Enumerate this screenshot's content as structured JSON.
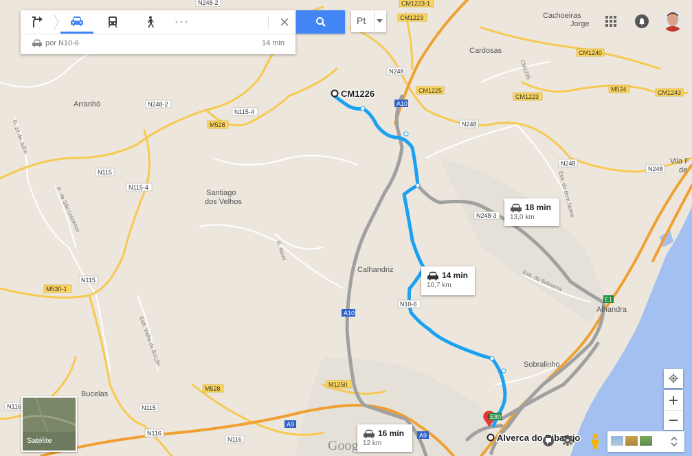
{
  "directions_panel": {
    "modes": [
      "directions",
      "car",
      "transit",
      "walking",
      "more"
    ],
    "route_summary": "por N10-6",
    "route_time": "14 min",
    "close_label": "×"
  },
  "language": {
    "selected": "Pt"
  },
  "route_boxes": {
    "primary": {
      "time": "14 min",
      "distance": "10,7 km"
    },
    "alt_east": {
      "time": "18 min",
      "distance": "13,0 km"
    },
    "alt_south": {
      "time": "16 min",
      "distance": "12 km"
    }
  },
  "markers": {
    "origin": "CM1226",
    "destination": "Alverca do Ribatejo"
  },
  "places": {
    "cachoeiras": "Cachoeiras",
    "jorge": "Jorge",
    "cardosas": "Cardosas",
    "arranho": "Arranhó",
    "santiago": "Santiago",
    "dos_velhos": "dos Velhos",
    "calhandriz": "Calhandriz",
    "alhandra": "Alhandra",
    "sobralinho": "Sobralinho",
    "bucelas": "Bucelas",
    "vila_f": "Vila F",
    "de": "de"
  },
  "streets": {
    "r_26_julho": "R. 26 de Julho",
    "r_sao_lourenco": "R. de São Lourenço",
    "r_nova": "R. Nova",
    "estr_velha": "Estr. Velha do Boição",
    "estr_bom_nome": "Estr. do Bom Nome",
    "estr_subserra": "Estr. da Subserra",
    "cm1235": "CM1235"
  },
  "road_shields": {
    "n248_2_top": "N248-2",
    "cm1223_1": "CM1223-1",
    "cm1223_a": "CM1223",
    "cm1240": "CM1240",
    "n248_a": "N248",
    "cm1225": "CM1225",
    "cm1223_b": "CM1223",
    "m524": "M524",
    "cm1243": "CM1243",
    "n248_2": "N248-2",
    "n115_4_a": "N115-4",
    "m528_a": "M528",
    "a10_a": "A10",
    "n248_b": "N248",
    "n248_c": "N248",
    "n248_d": "N248",
    "n115_a": "N115",
    "n115_4_b": "N115-4",
    "n248_3": "N248-3",
    "n116_a": "N116",
    "m530_1": "M530-1",
    "n115_b": "N115",
    "n10_6": "N10-6",
    "a10_b": "A10",
    "e1": "E1",
    "m1250": "M1250",
    "m528_b": "M528",
    "n116_b": "N116",
    "n115_c": "N115",
    "n116_c": "N116",
    "n116_d": "N116",
    "a9_a": "A9",
    "a9_b": "A9",
    "e80": "E80"
  },
  "satellite_label": "Satélite",
  "google_logo": "Google",
  "colors": {
    "route_primary": "#1ba1f1",
    "route_alt": "#a0a0a0",
    "motorway": "#f0a030",
    "primary_road": "#fcd55b",
    "water": "#a3c0f1",
    "land": "#ece6dd",
    "accent": "#4285f4"
  }
}
